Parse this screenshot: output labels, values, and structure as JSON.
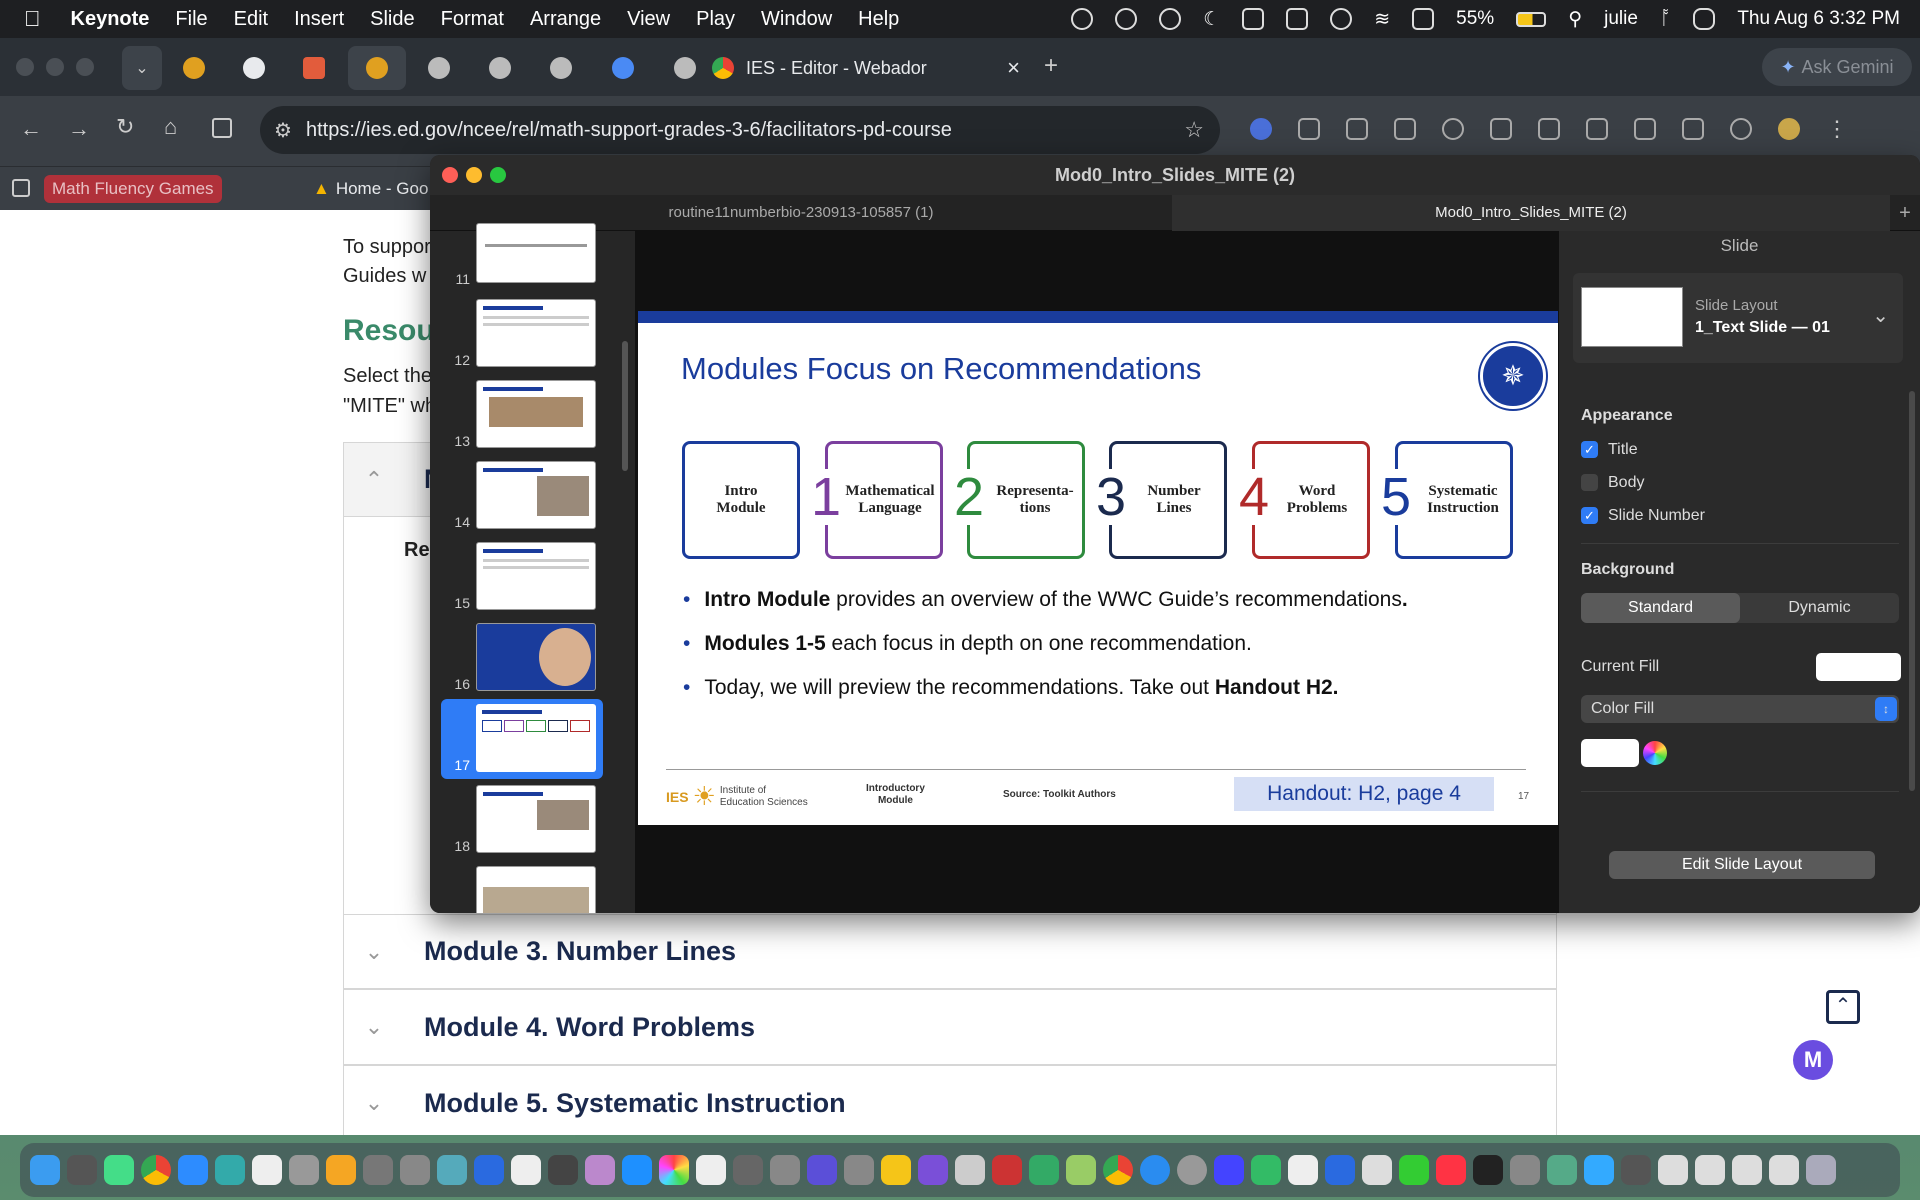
{
  "menubar": {
    "app": "Keynote",
    "items": [
      "File",
      "Edit",
      "Insert",
      "Slide",
      "Format",
      "Arrange",
      "View",
      "Play",
      "Window",
      "Help"
    ],
    "battery": "55%",
    "user": "julie",
    "datetime": "Thu Aug 6  3:32 PM"
  },
  "browser": {
    "active_tab_title": "IES - Editor - Webador",
    "url": "https://ies.ed.gov/ncee/rel/math-support-grades-3-6/facilitators-pd-course",
    "ask_button": "Ask Gemini",
    "bookmarks": [
      "Math Fluency Games",
      "Home - Goo"
    ]
  },
  "webpage": {
    "para1_line1": "To suppor",
    "para1_line2": "Guides w",
    "section_heading": "Resou",
    "para2_line1": "Select the",
    "para2_line2": "\"MITE\" wh",
    "accordion_partial_1": "N",
    "accordion_inner": "Re",
    "accordion_partial_2": "N",
    "accordion_partial_3": "N",
    "accordions": [
      "Module 3. Number Lines",
      "Module 4. Word Problems",
      "Module 5. Systematic Instruction"
    ]
  },
  "keynote": {
    "window_title": "Mod0_Intro_Slides_MITE (2)",
    "tabs": [
      "routine11numberbio-230913-105857 (1)",
      "Mod0_Intro_Slides_MITE (2)"
    ],
    "add_tab": "+",
    "slide_numbers": [
      "11",
      "12",
      "13",
      "14",
      "15",
      "16",
      "17",
      "18"
    ],
    "selected_slide": "17"
  },
  "slide": {
    "title": "Modules Focus on Recommendations",
    "boxes": [
      {
        "num": "",
        "label": "Intro\nModule",
        "color": "#1a3c9c"
      },
      {
        "num": "1",
        "label": "Mathematical\nLanguage",
        "color": "#7b3f9e"
      },
      {
        "num": "2",
        "label": "Representa-\ntions",
        "color": "#2e8b3e"
      },
      {
        "num": "3",
        "label": "Number\nLines",
        "color": "#1b2a4e"
      },
      {
        "num": "4",
        "label": "Word\nProblems",
        "color": "#b02a2a"
      },
      {
        "num": "5",
        "label": "Systematic\nInstruction",
        "color": "#1a3c9c"
      }
    ],
    "bullet1_bold": "Intro Module",
    "bullet1_rest": " provides an overview of the WWC Guide’s recommendations",
    "bullet1_end": ".",
    "bullet2_bold": "Modules 1-5",
    "bullet2_rest": " each focus in depth on one recommendation.",
    "bullet3_rest": "Today, we will preview the recommendations. Take out ",
    "bullet3_bold": "Handout H2.",
    "footer_ies": "IES",
    "footer_inst_line1": "Institute of",
    "footer_inst_line2": "Education Sciences",
    "footer_module_line1": "Introductory",
    "footer_module_line2": "Module",
    "footer_source": "Source: Toolkit Authors",
    "footer_handout": "Handout: H2, page 4",
    "footer_page": "17"
  },
  "inspector": {
    "header": "Slide",
    "layout_label": "Slide Layout",
    "layout_value": "1_Text Slide — 01",
    "appearance": "Appearance",
    "title_cb": "Title",
    "body_cb": "Body",
    "slide_number_cb": "Slide Number",
    "title_checked": true,
    "body_checked": false,
    "slide_number_checked": true,
    "background": "Background",
    "standard": "Standard",
    "dynamic": "Dynamic",
    "current_fill": "Current Fill",
    "fill_type": "Color Fill",
    "edit_layout": "Edit Slide Layout"
  },
  "colors": {
    "accent_blue": "#1a3c9c",
    "checkbox_blue": "#2f7cf6",
    "handout_bg": "#d6dff5"
  }
}
